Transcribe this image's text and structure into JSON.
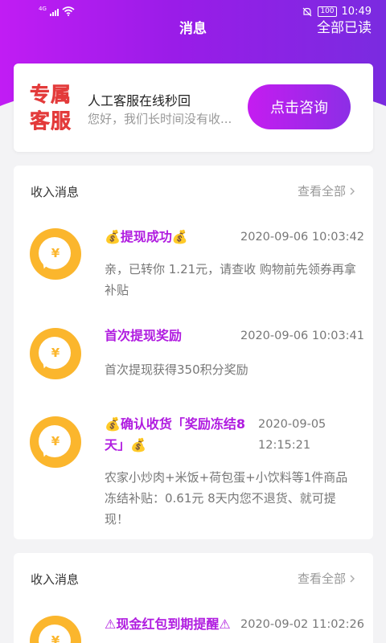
{
  "status_bar": {
    "network": "4G",
    "battery": "100",
    "time": "10:49"
  },
  "header": {
    "title": "消息",
    "mark_all_read": "全部已读"
  },
  "customer_service": {
    "logo_line1": "专属",
    "logo_line2": "客服",
    "title": "人工客服在线秒回",
    "subtitle": "您好，我们长时间没有收...",
    "button": "点击咨询"
  },
  "sections": [
    {
      "heading": "收入消息",
      "view_all": "查看全部",
      "messages": [
        {
          "title": "💰提现成功💰",
          "time": "2020-09-06 10:03:42",
          "body": "亲，已转你 1.21元，请查收 购物前先领券再拿补贴"
        },
        {
          "title": "首次提现奖励",
          "time": "2020-09-06 10:03:41",
          "body": "首次提现获得350积分奖励"
        },
        {
          "title_line1": "💰确认收货「奖励冻结8",
          "title_line2": "天」💰",
          "time_line1": "2020-09-05",
          "time_line2": "12:15:21",
          "body": "农家小炒肉+米饭+荷包蛋+小饮料等1件商品冻结补贴：0.61元 8天内您不退货、就可提现！"
        }
      ]
    },
    {
      "heading": "收入消息",
      "view_all": "查看全部",
      "messages": [
        {
          "title": "⚠现金红包到期提醒⚠",
          "time": "2020-09-02 11:02:26"
        }
      ]
    }
  ],
  "colors": {
    "brand_purple": "#b01ce0",
    "coin_yellow": "#fbb62d",
    "logo_red": "#e33b3b"
  }
}
